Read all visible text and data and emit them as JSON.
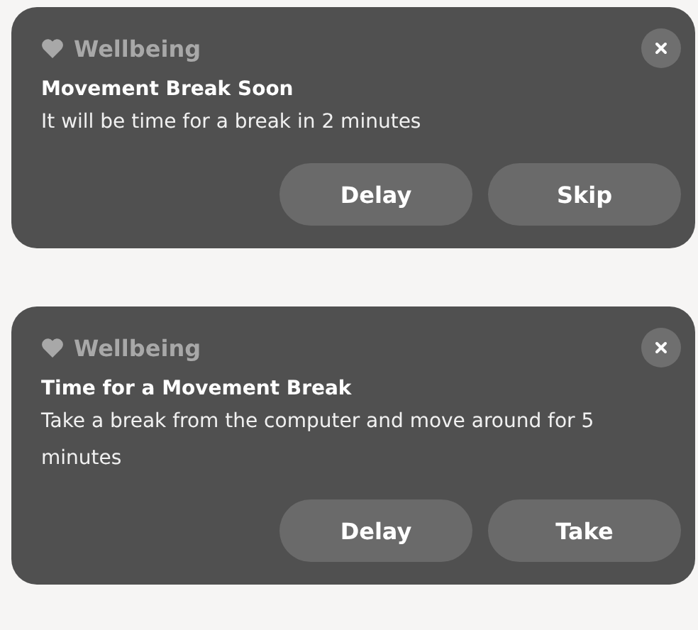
{
  "notifications": [
    {
      "app": "Wellbeing",
      "title": "Movement Break Soon",
      "body": "It will be time for a break in 2 minutes",
      "buttons": [
        "Delay",
        "Skip"
      ]
    },
    {
      "app": "Wellbeing",
      "title": "Time for a Movement Break",
      "body": "Take a break from the computer and move around for 5 minutes",
      "buttons": [
        "Delay",
        "Take"
      ]
    }
  ]
}
